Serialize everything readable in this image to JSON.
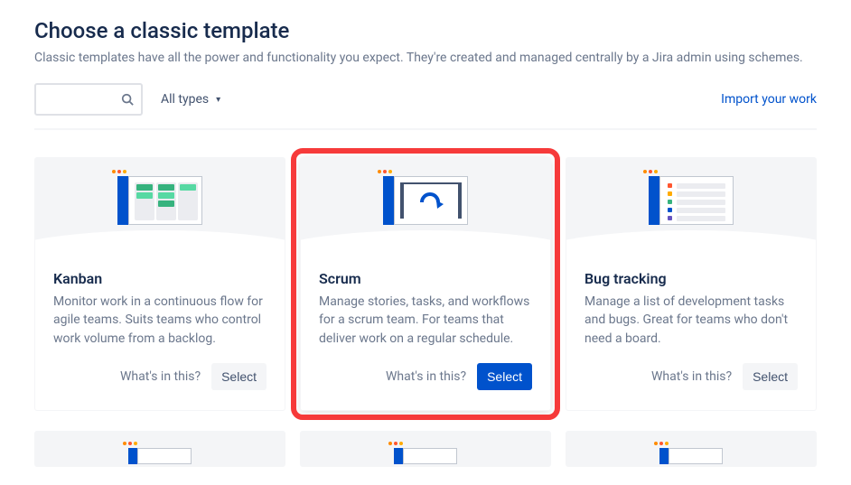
{
  "title": "Choose a classic template",
  "subtitle": "Classic templates have all the power and functionality you expect. They're created and managed centrally by a Jira admin using schemes.",
  "filter": {
    "dropdown_label": "All types"
  },
  "import_link": "Import your work",
  "cards": [
    {
      "title": "Kanban",
      "description": "Monitor work in a continuous flow for agile teams. Suits teams who control work volume from a backlog.",
      "whats_in_this": "What's in this?",
      "select_label": "Select"
    },
    {
      "title": "Scrum",
      "description": "Manage stories, tasks, and workflows for a scrum team. For teams that deliver work on a regular schedule.",
      "whats_in_this": "What's in this?",
      "select_label": "Select"
    },
    {
      "title": "Bug tracking",
      "description": "Manage a list of development tasks and bugs. Great for teams who don't need a board.",
      "whats_in_this": "What's in this?",
      "select_label": "Select"
    }
  ]
}
